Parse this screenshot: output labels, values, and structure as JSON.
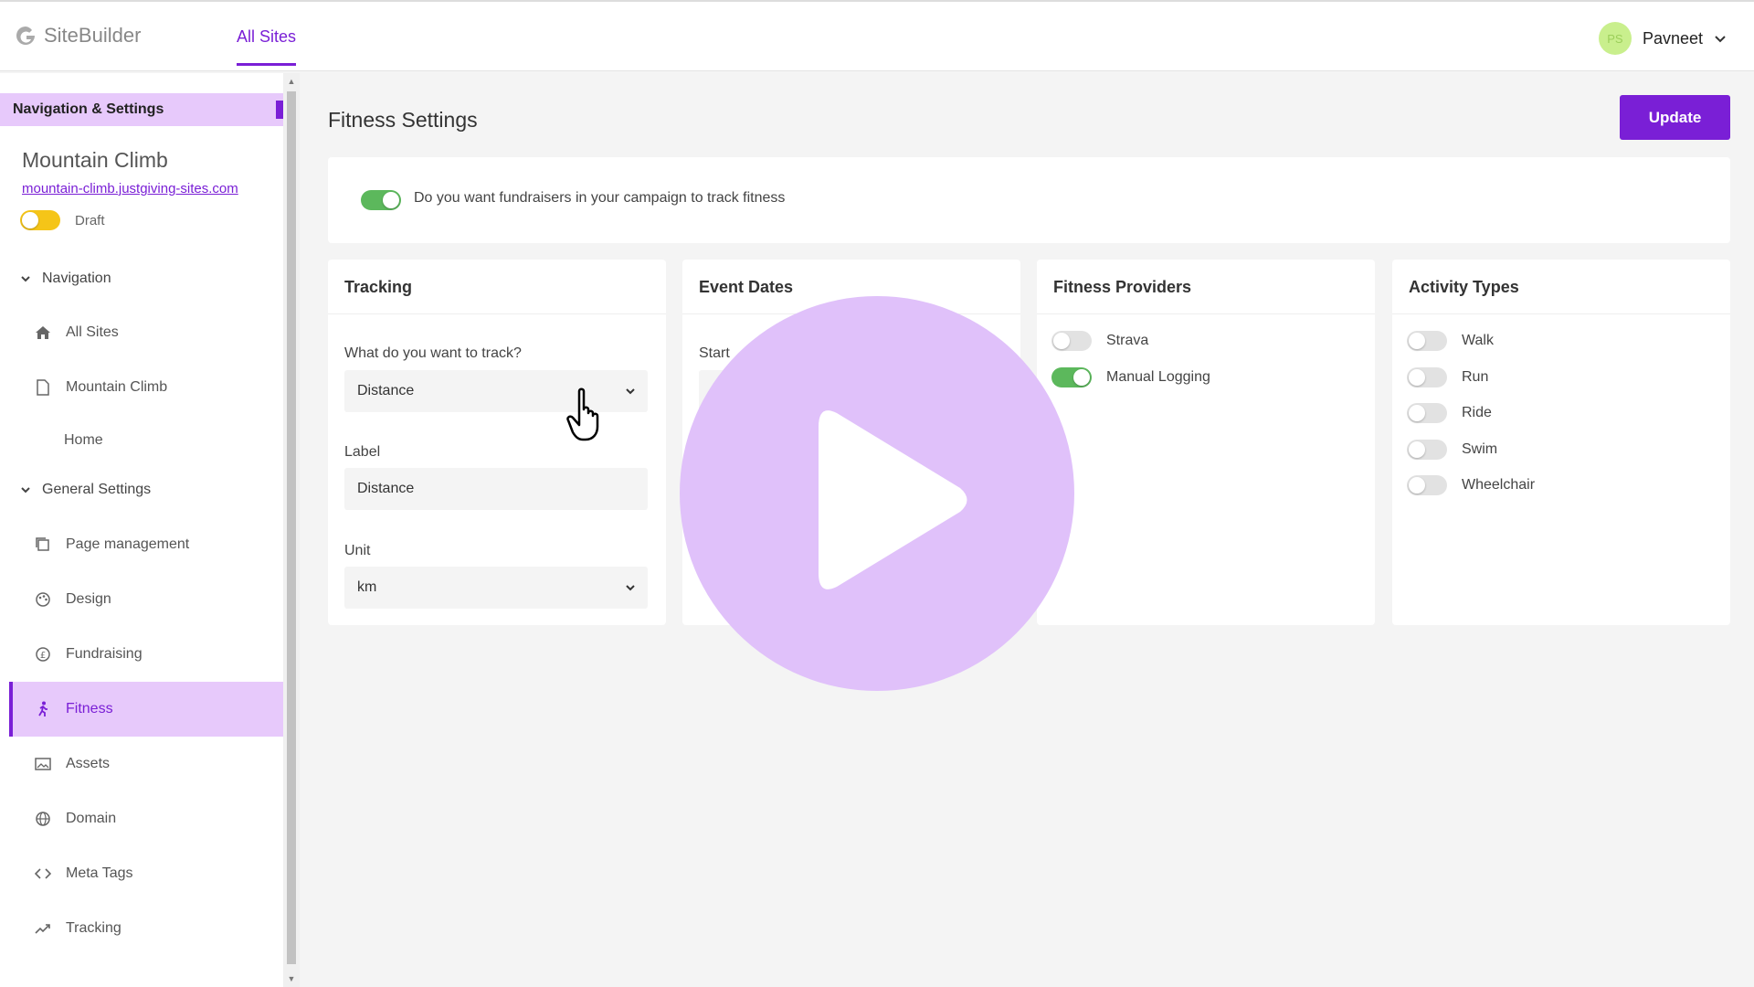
{
  "app": {
    "name": "SiteBuilder"
  },
  "top_nav": {
    "tab_all_sites": "All Sites"
  },
  "user": {
    "initials": "PS",
    "name": "Pavneet"
  },
  "sidebar": {
    "header": "Navigation & Settings",
    "site_name": "Mountain Climb",
    "site_url": "mountain-climb.justgiving-sites.com",
    "draft_label": "Draft",
    "navigation_section": "Navigation",
    "general_section": "General Settings",
    "items": [
      {
        "label": "All Sites",
        "icon": "home-icon"
      },
      {
        "label": "Mountain Climb",
        "icon": "page-icon"
      },
      {
        "label": "Home",
        "icon": ""
      },
      {
        "label": "Page management",
        "icon": "pages-icon"
      },
      {
        "label": "Design",
        "icon": "palette-icon"
      },
      {
        "label": "Fundraising",
        "icon": "currency-icon"
      },
      {
        "label": "Fitness",
        "icon": "run-icon"
      },
      {
        "label": "Assets",
        "icon": "image-icon"
      },
      {
        "label": "Domain",
        "icon": "globe-icon"
      },
      {
        "label": "Meta Tags",
        "icon": "code-icon"
      },
      {
        "label": "Tracking",
        "icon": "trend-icon"
      }
    ]
  },
  "main": {
    "title": "Fitness Settings",
    "update_label": "Update",
    "track_question": "Do you want fundraisers in your campaign to track fitness",
    "tracking": {
      "title": "Tracking",
      "what_label": "What do you want to track?",
      "what_value": "Distance",
      "label_label": "Label",
      "label_value": "Distance",
      "unit_label": "Unit",
      "unit_value": "km"
    },
    "event_dates": {
      "title": "Event Dates",
      "start_label": "Start"
    },
    "providers": {
      "title": "Fitness Providers",
      "items": [
        {
          "label": "Strava",
          "on": false
        },
        {
          "label": "Manual Logging",
          "on": true
        }
      ]
    },
    "activity": {
      "title": "Activity Types",
      "items": [
        {
          "label": "Walk"
        },
        {
          "label": "Run"
        },
        {
          "label": "Ride"
        },
        {
          "label": "Swim"
        },
        {
          "label": "Wheelchair"
        }
      ]
    }
  },
  "colors": {
    "accent": "#7a1fd6",
    "highlight": "#e7c9fb",
    "toggle_on": "#5cb85c",
    "draft_toggle": "#f5c518"
  }
}
